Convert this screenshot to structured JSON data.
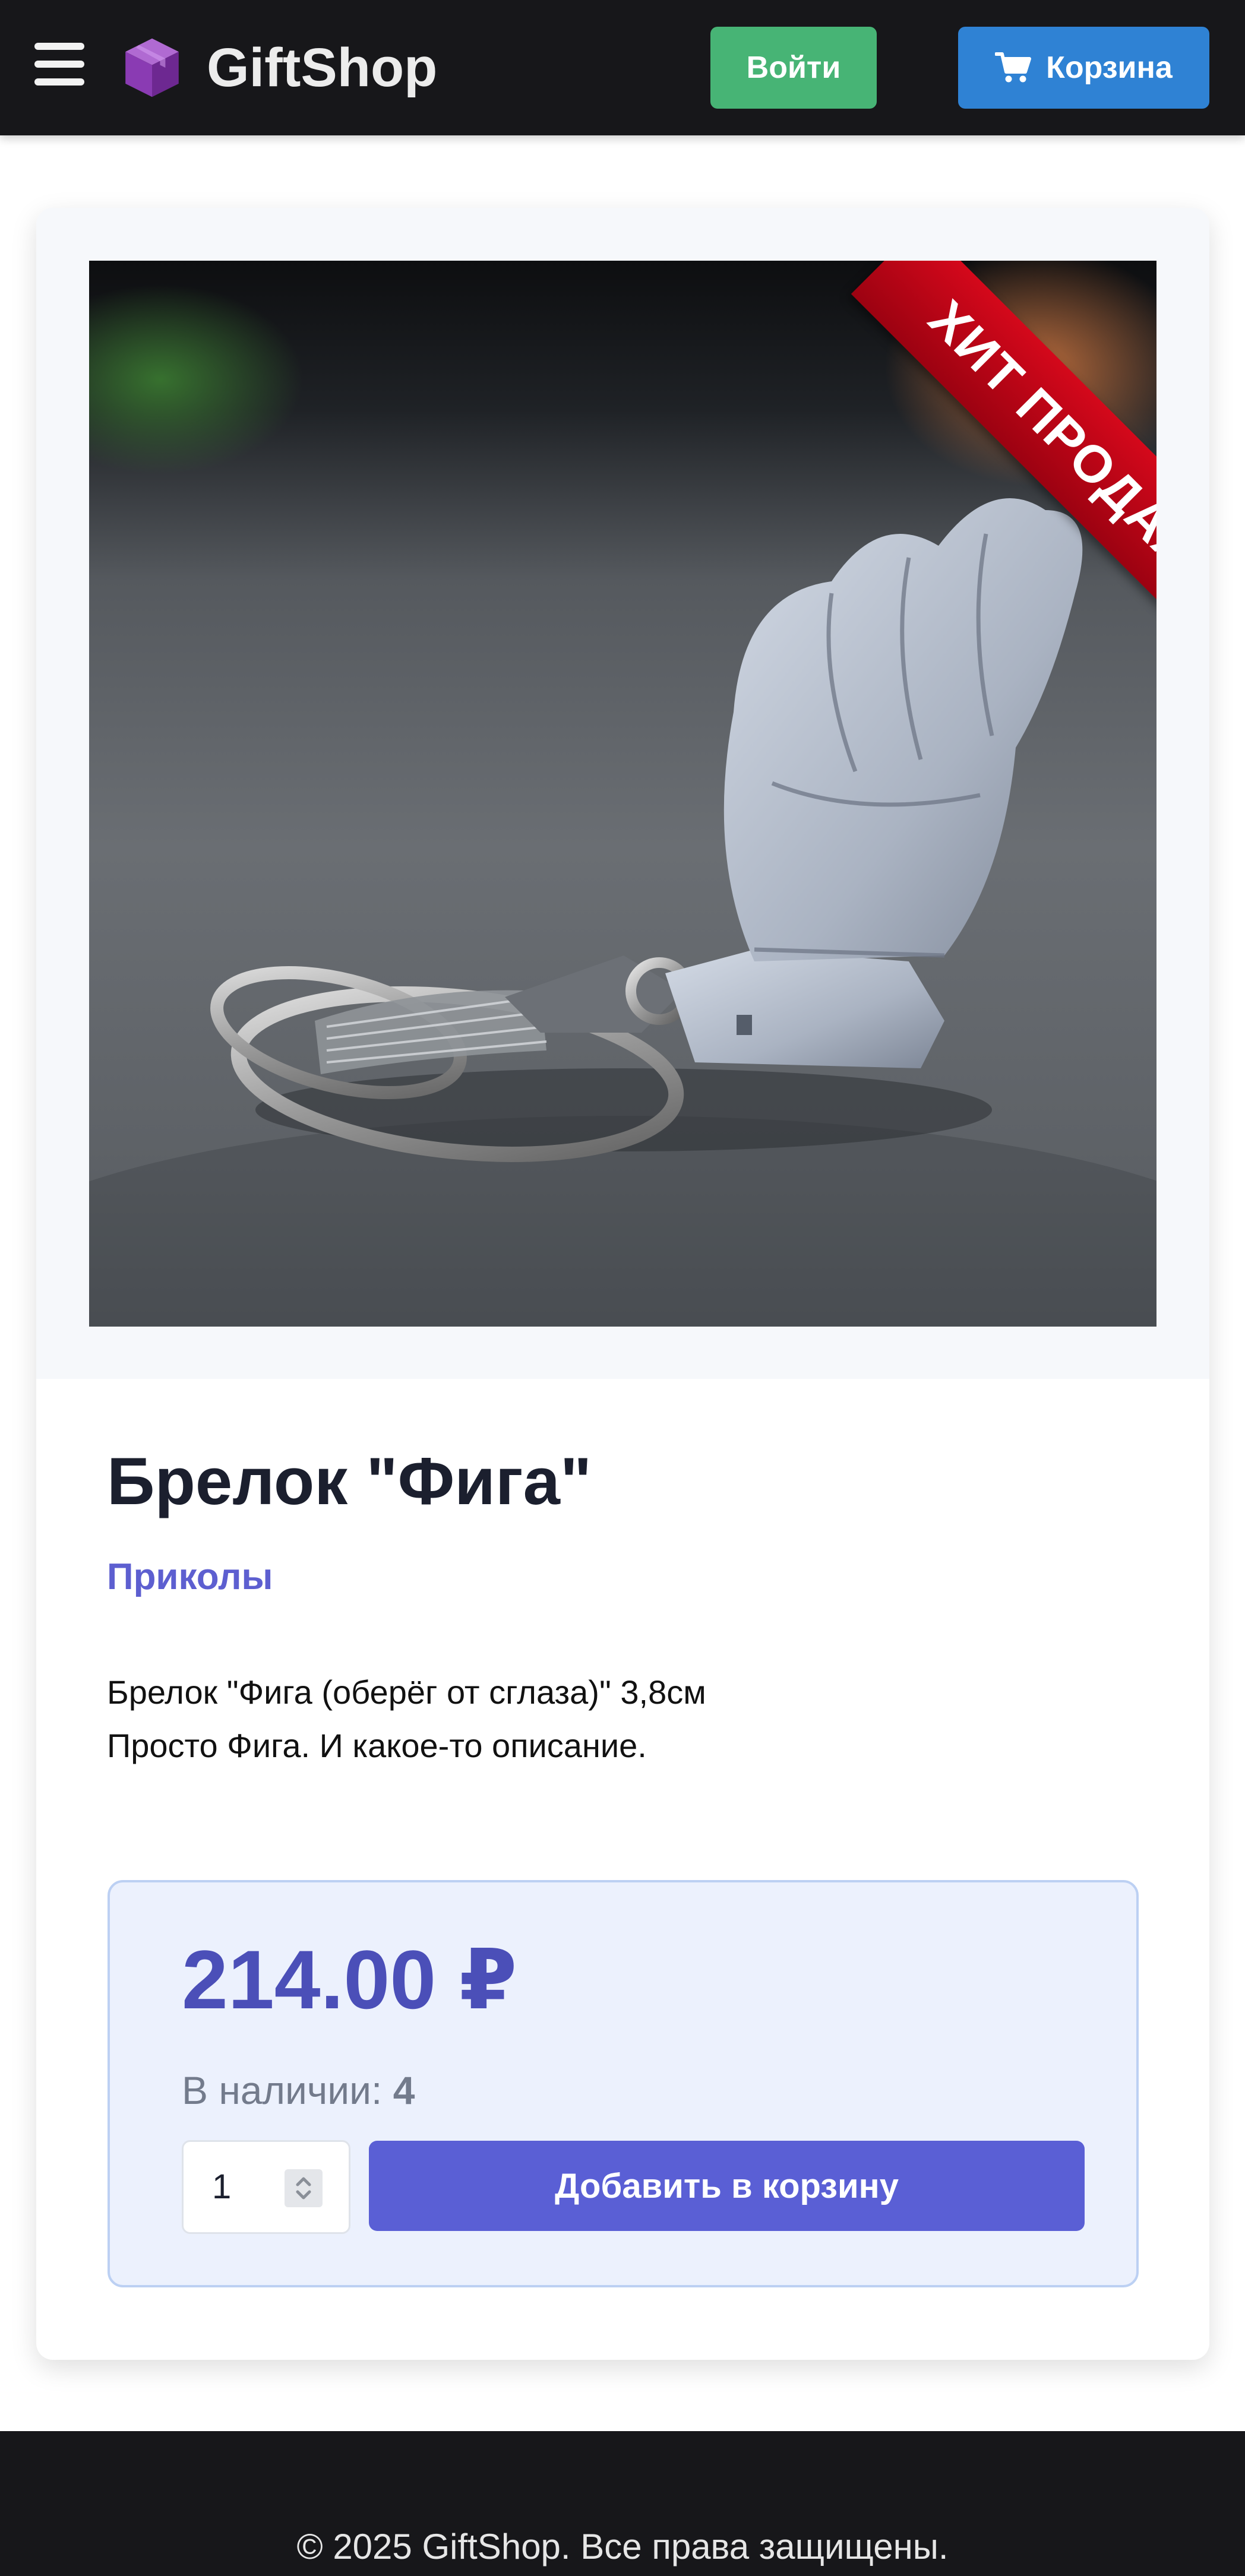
{
  "header": {
    "menu_icon": "hamburger-icon",
    "logo_icon": "box-icon",
    "brand": "GiftShop",
    "login_label": "Войти",
    "cart_icon": "shopping-cart-icon",
    "cart_label": "Корзина"
  },
  "product": {
    "image_alt": "Брелок \"Фига\"",
    "ribbon": "ХИТ ПРОДАЖ",
    "title": "Брелок \"Фига\"",
    "category": "Приколы",
    "description_lines": [
      "Брелок \"Фига (оберёг от сглаза)\" 3,8см",
      "Просто Фига. И какое-то описание."
    ],
    "price": "214.00 ₽",
    "stock_label": "В наличии:",
    "stock_value": "4",
    "quantity": "1",
    "add_to_cart_label": "Добавить в корзину"
  },
  "footer": {
    "copyright": "© 2025 GiftShop. Все права защищены."
  },
  "colors": {
    "header_bg": "#17171a",
    "login_button": "#47b475",
    "cart_button": "#2f82d4",
    "category": "#5d5fd0",
    "price": "#4b4fb8",
    "add_button": "#5a5fd5",
    "ribbon": "#c8061a"
  }
}
